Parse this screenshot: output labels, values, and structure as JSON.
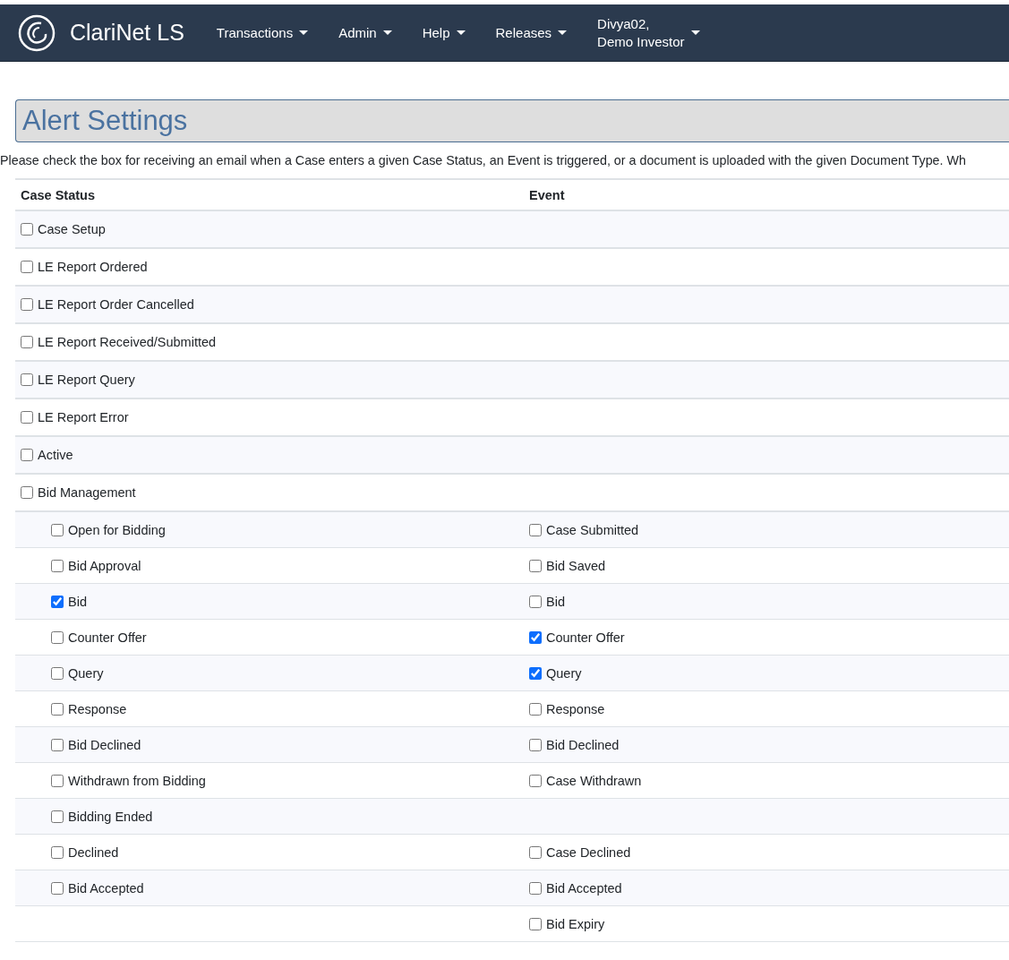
{
  "navbar": {
    "brand": "ClariNet LS",
    "menus": [
      {
        "label": "Transactions"
      },
      {
        "label": "Admin"
      },
      {
        "label": "Help"
      },
      {
        "label": "Releases"
      }
    ],
    "user": {
      "line_1": "Divya02,",
      "line_2": "Demo Investor"
    }
  },
  "page": {
    "title": "Alert Settings",
    "description": "Please check the box for receiving an email when a Case enters a given Case Status, an Event is triggered, or a document is uploaded with the given Document Type. Wh"
  },
  "table": {
    "columns": [
      "Case Status",
      "Event"
    ],
    "rows": [
      {
        "label": "Case Setup",
        "checked": false
      },
      {
        "label": "LE Report Ordered",
        "checked": false
      },
      {
        "label": "LE Report Order Cancelled",
        "checked": false
      },
      {
        "label": "LE Report Received/Submitted",
        "checked": false
      },
      {
        "label": "LE Report Query",
        "checked": false
      },
      {
        "label": "LE Report Error",
        "checked": false
      },
      {
        "label": "Active",
        "checked": false
      },
      {
        "label": "Bid Management",
        "checked": false,
        "children": [
          {
            "status": {
              "label": "Open for Bidding",
              "checked": false
            },
            "event": {
              "label": "Case Submitted",
              "checked": false
            }
          },
          {
            "status": {
              "label": "Bid Approval",
              "checked": false
            },
            "event": {
              "label": "Bid Saved",
              "checked": false
            }
          },
          {
            "status": {
              "label": "Bid",
              "checked": true
            },
            "event": {
              "label": "Bid",
              "checked": false
            }
          },
          {
            "status": {
              "label": "Counter Offer",
              "checked": false
            },
            "event": {
              "label": "Counter Offer",
              "checked": true
            }
          },
          {
            "status": {
              "label": "Query",
              "checked": false
            },
            "event": {
              "label": "Query",
              "checked": true
            }
          },
          {
            "status": {
              "label": "Response",
              "checked": false
            },
            "event": {
              "label": "Response",
              "checked": false
            }
          },
          {
            "status": {
              "label": "Bid Declined",
              "checked": false
            },
            "event": {
              "label": "Bid Declined",
              "checked": false
            }
          },
          {
            "status": {
              "label": "Withdrawn from Bidding",
              "checked": false
            },
            "event": {
              "label": "Case Withdrawn",
              "checked": false
            }
          },
          {
            "status": {
              "label": "Bidding Ended",
              "checked": false
            }
          },
          {
            "status": {
              "label": "Declined",
              "checked": false
            },
            "event": {
              "label": "Case Declined",
              "checked": false
            }
          },
          {
            "status": {
              "label": "Bid Accepted",
              "checked": false
            },
            "event": {
              "label": "Bid Accepted",
              "checked": false
            }
          },
          {
            "event": {
              "label": "Bid Expiry",
              "checked": false
            }
          }
        ]
      }
    ]
  }
}
